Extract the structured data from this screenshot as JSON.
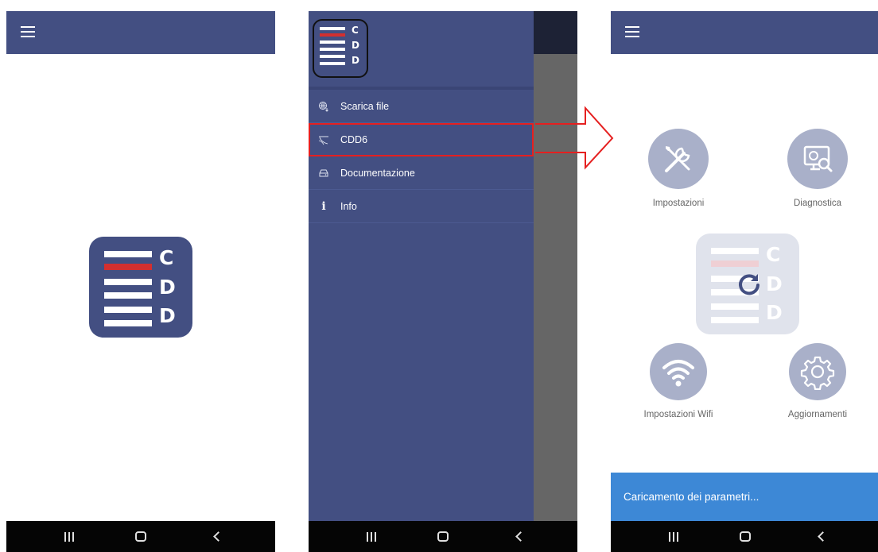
{
  "logo": {
    "letters": [
      "C",
      "D",
      "D"
    ]
  },
  "drawer": {
    "items": [
      {
        "label": "Scarica file",
        "icon": "download-globe-icon"
      },
      {
        "label": "CDD6",
        "icon": "cable-icon",
        "highlighted": true
      },
      {
        "label": "Documentazione",
        "icon": "drive-icon"
      },
      {
        "label": "Info",
        "icon": "info-icon",
        "glyph": "i"
      }
    ]
  },
  "dashboard": {
    "tiles": [
      {
        "label": "Impostazioni",
        "icon": "tools-icon"
      },
      {
        "label": "Diagnostica",
        "icon": "monitor-search-icon"
      },
      {
        "label": "Impostazioni Wifi",
        "icon": "wifi-icon"
      },
      {
        "label": "Aggiornamenti",
        "icon": "gear-icon"
      }
    ],
    "snackbar": "Caricamento dei parametri..."
  },
  "colors": {
    "primary": "#434f82",
    "logo_red": "#d32f2f",
    "tile_circle": "#a9b0c9",
    "snackbar": "#3d88d6",
    "annotation": "#e52020",
    "navbar": "#050505"
  }
}
